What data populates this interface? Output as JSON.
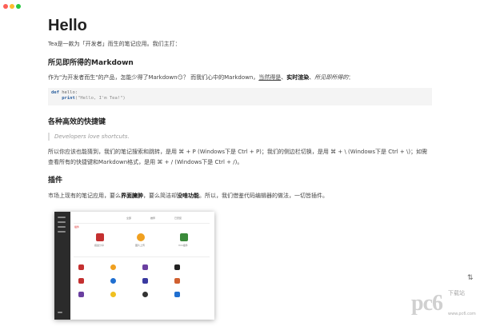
{
  "doc": {
    "title": "Hello",
    "intro": "Tea是一款为「开发者」而生的笔记应用。我们主打：",
    "section1": {
      "heading": "所见即所得的Markdown",
      "p_a": "作为\"为开发者而生\"的产品，怎能少得了Markdown😏？ 而我们心中的Markdown，",
      "p_underline": "当然得是",
      "p_sep1": "、",
      "p_bold": "实时渲染",
      "p_sep2": "、",
      "p_italic": "所见即所得的",
      "p_end": "："
    },
    "code": {
      "line1_kw": "def",
      "line1_rest": " hello:",
      "line2_kw": "print",
      "line2_rest": "(\"Hello, I'm Tea!\")"
    },
    "section2": {
      "heading": "各种高效的快捷键",
      "quote": "Developers love shortcuts.",
      "p1": "所以你应该也能猜到，我们的笔记搜索和跳转，是用 ⌘ + P (Windows下是 Ctrl + P)；我们的侧边栏切换，是用 ⌘ + \\ (Windows下是 Ctrl + \\)；如需",
      "p2": "查看所有的快捷键和Markdown格式，是用 ⌘ + / (Windows下是 Ctrl + /)。"
    },
    "section3": {
      "heading": "插件",
      "p_a": "市场上现有的笔记应用，要么",
      "p_bold1": "界面臃肿",
      "p_b": "，要么简洁却",
      "p_bold2": "没啥功能",
      "p_c": "。所以，我们借鉴代码编辑器的做法，一切皆插件。"
    }
  },
  "embedded_screenshot": {
    "title_label": "插件",
    "tab_labels": [
      "全部",
      "推荐",
      "已安装"
    ],
    "featured": [
      "掘金分享",
      "图片上传",
      "Vim插件"
    ]
  },
  "scroll_indicator": "⇅",
  "watermark": {
    "brand": "pc6",
    "sub": "下载站",
    "url": "www.pc6.com"
  },
  "colors": {
    "traffic_red": "#fd5f57",
    "traffic_yellow": "#febc2e",
    "traffic_green": "#28c840",
    "code_bg": "#f4f4f4"
  }
}
